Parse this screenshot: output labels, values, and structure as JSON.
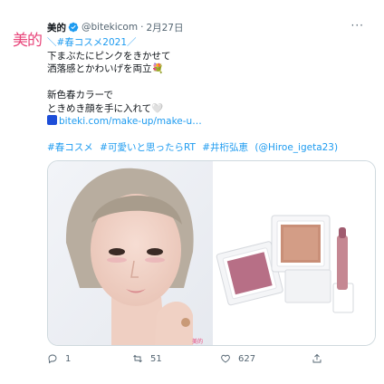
{
  "account": {
    "avatar_text": "美的",
    "name": "美的",
    "handle": "@bitekicom",
    "separator": "·",
    "date": "2月27日",
    "more": "···"
  },
  "tweet": {
    "line1": "＼#春コスメ2021／",
    "line2": "下まぶたにピンクをきかせて",
    "line3": "洒落感とかわいげを両立💐",
    "line4": "新色春カラーで",
    "line5": "ときめき顔を手に入れて🤍",
    "link": "biteki.com/make-up/make-u…",
    "hashtags": [
      "#春コスメ",
      "#可愛いと思ったらRT",
      "#井桁弘恵"
    ],
    "mention": "(@Hiroe_igeta23)"
  },
  "media": {
    "watermark": "美的"
  },
  "actions": {
    "reply_count": "1",
    "retweet_count": "51",
    "like_count": "627"
  }
}
